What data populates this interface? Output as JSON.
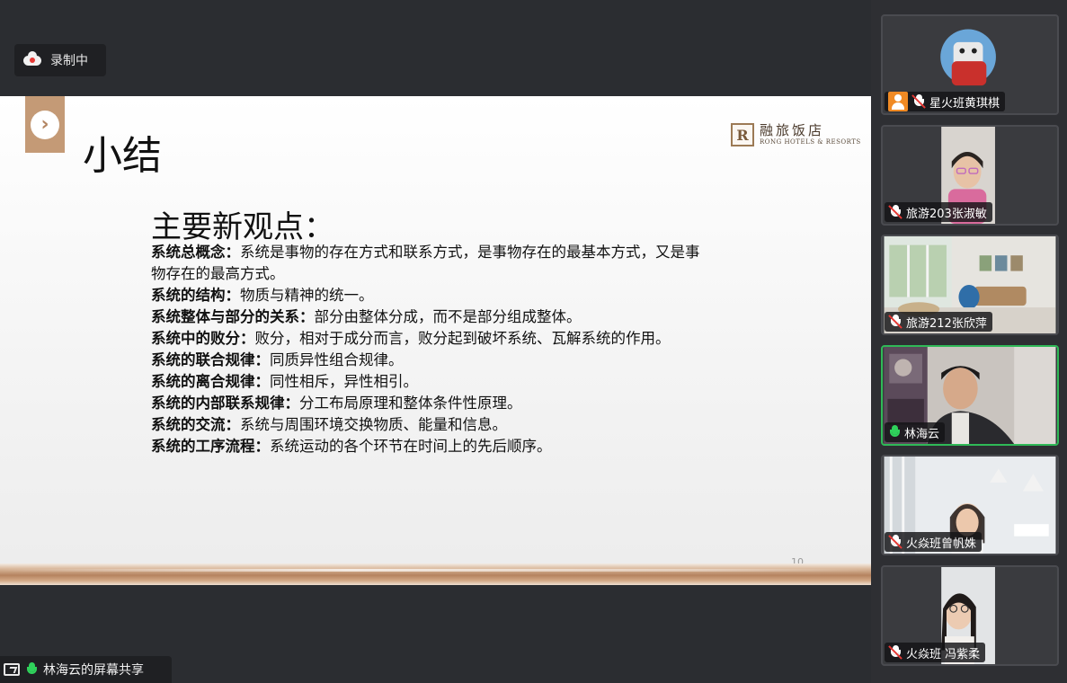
{
  "recording": {
    "label": "录制中"
  },
  "slide": {
    "title": "小结",
    "logo": {
      "mark": "R",
      "name_cn": "融旅饭店",
      "name_en": "RONG HOTELS & RESORTS"
    },
    "heading": "主要新观点：",
    "points": [
      {
        "term": "系统总概念：",
        "text": "系统是事物的存在方式和联系方式，是事物存在的最基本方式，又是事物存在的最高方式。"
      },
      {
        "term": "系统的结构：",
        "text": "物质与精神的统一。"
      },
      {
        "term": "系统整体与部分的关系：",
        "text": "部分由整体分成，而不是部分组成整体。"
      },
      {
        "term": "系统中的败分：",
        "text": "败分，相对于成分而言，败分起到破坏系统、瓦解系统的作用。"
      },
      {
        "term": "系统的联合规律：",
        "text": "同质异性组合规律。"
      },
      {
        "term": "系统的离合规律：",
        "text": "同性相斥，异性相引。"
      },
      {
        "term": "系统的内部联系规律：",
        "text": "分工布局原理和整体条件性原理。"
      },
      {
        "term": "系统的交流：",
        "text": "系统与周围环境交换物质、能量和信息。"
      },
      {
        "term": "系统的工序流程：",
        "text": "系统运动的各个环节在时间上的先后顺序。"
      }
    ],
    "page_number": "10"
  },
  "share": {
    "label": "林海云的屏幕共享"
  },
  "participants": [
    {
      "name": "星火班黄琪棋",
      "mic": "muted",
      "host": true
    },
    {
      "name": "旅游203张淑敏",
      "mic": "muted"
    },
    {
      "name": "旅游212张欣萍",
      "mic": "muted"
    },
    {
      "name": "林海云",
      "mic": "on",
      "active": true
    },
    {
      "name": "火焱班曾帆姝",
      "mic": "muted"
    },
    {
      "name": "火焱班 冯紫柔",
      "mic": "muted"
    }
  ],
  "colors": {
    "accent": "#c49a76",
    "speaking": "#2fb957",
    "muted_slash": "#e53935"
  }
}
